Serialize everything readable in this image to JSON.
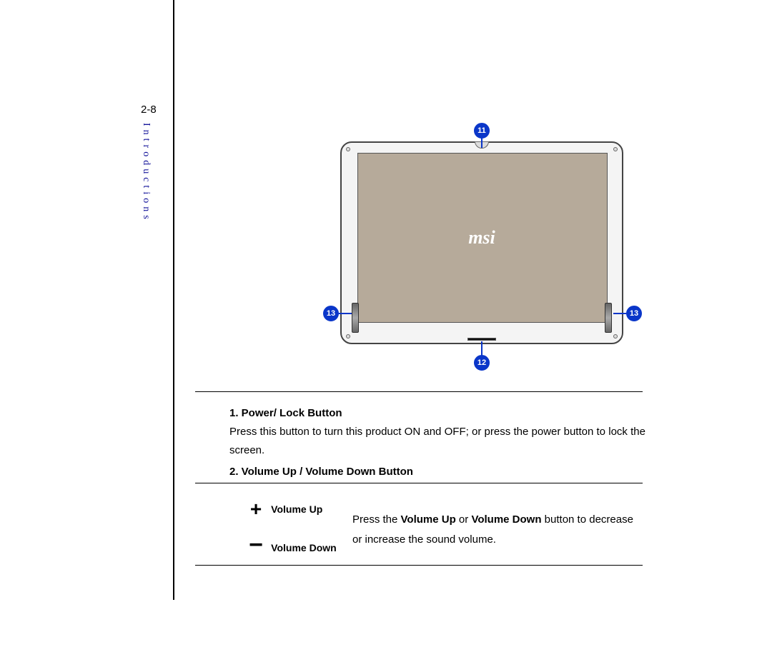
{
  "page_number": "2-8",
  "section_label": "Introductions",
  "device": {
    "logo": "msi",
    "callouts": {
      "top": "11",
      "bottom": "12",
      "left": "13",
      "right": "13"
    }
  },
  "items": {
    "item1": {
      "heading": "1.  Power/ Lock Button",
      "body": "Press this button to turn this product ON and OFF; or press the power button to lock the screen."
    },
    "item2": {
      "heading": "2.  Volume Up / Volume Down Button",
      "vol_up_label": "Volume Up",
      "vol_down_label": "Volume Down",
      "desc_pre": "Press the ",
      "desc_b1": "Volume Up",
      "desc_mid": " or ",
      "desc_b2": "Volume Down",
      "desc_post": " button to decrease or increase the sound volume."
    }
  }
}
